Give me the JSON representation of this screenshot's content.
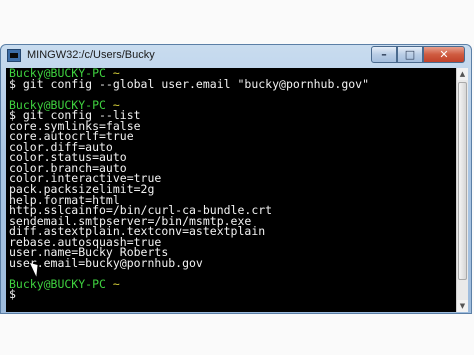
{
  "window": {
    "title": "MINGW32:/c/Users/Bucky",
    "minimize_glyph": "–",
    "maximize_glyph": "□",
    "close_glyph": "✕"
  },
  "terminal": {
    "prompt_color": "#3fd13f",
    "text_color": "#f2f2f2",
    "background": "#000000",
    "lines": [
      {
        "prompt": "Bucky@BUCKY-PC",
        "path": "~"
      },
      {
        "text": "$ git config --global user.email \"bucky@pornhub.gov\""
      },
      {
        "text": ""
      },
      {
        "prompt": "Bucky@BUCKY-PC",
        "path": "~"
      },
      {
        "text": "$ git config --list"
      },
      {
        "text": "core.symlinks=false"
      },
      {
        "text": "core.autocrlf=true"
      },
      {
        "text": "color.diff=auto"
      },
      {
        "text": "color.status=auto"
      },
      {
        "text": "color.branch=auto"
      },
      {
        "text": "color.interactive=true"
      },
      {
        "text": "pack.packsizelimit=2g"
      },
      {
        "text": "help.format=html"
      },
      {
        "text": "http.sslcainfo=/bin/curl-ca-bundle.crt"
      },
      {
        "text": "sendemail.smtpserver=/bin/msmtp.exe"
      },
      {
        "text": "diff.astextplain.textconv=astextplain"
      },
      {
        "text": "rebase.autosquash=true"
      },
      {
        "text": "user.name=Bucky Roberts"
      },
      {
        "text": "user.email=bucky@pornhub.gov"
      },
      {
        "text": ""
      },
      {
        "prompt": "Bucky@BUCKY-PC",
        "path": "~"
      },
      {
        "text": "$"
      }
    ]
  },
  "scrollbar": {
    "up_glyph": "▲",
    "down_glyph": "▼"
  }
}
